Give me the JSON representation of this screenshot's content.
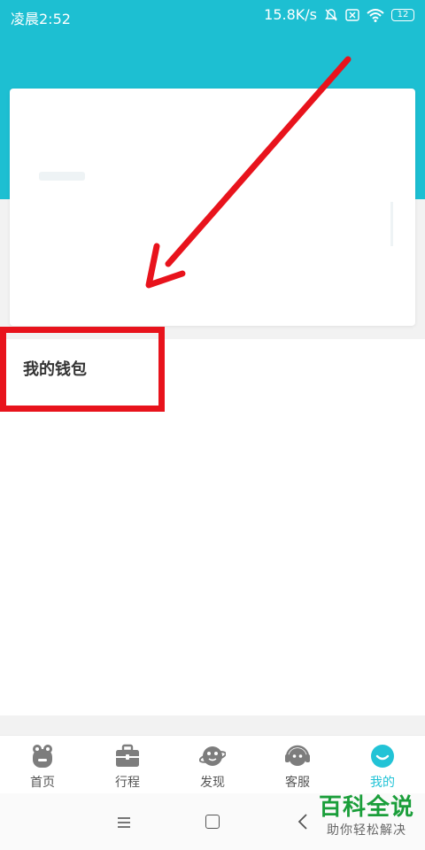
{
  "status_bar": {
    "time": "凌晨2:52",
    "network_speed": "15.8K/s",
    "battery": "12"
  },
  "wallet": {
    "label": "我的钱包"
  },
  "tabs": [
    {
      "label": "首页",
      "icon": "frog-icon"
    },
    {
      "label": "行程",
      "icon": "briefcase-icon"
    },
    {
      "label": "发现",
      "icon": "planet-icon"
    },
    {
      "label": "客服",
      "icon": "headset-icon"
    },
    {
      "label": "我的",
      "icon": "smiley-icon",
      "active": true
    }
  ],
  "watermark": {
    "title": "百科全说",
    "subtitle": "助你轻松解决"
  },
  "colors": {
    "header": "#1dbfd2",
    "accent": "#22c3d6",
    "annotation": "#e8131c",
    "watermark": "#1a9e3a"
  }
}
